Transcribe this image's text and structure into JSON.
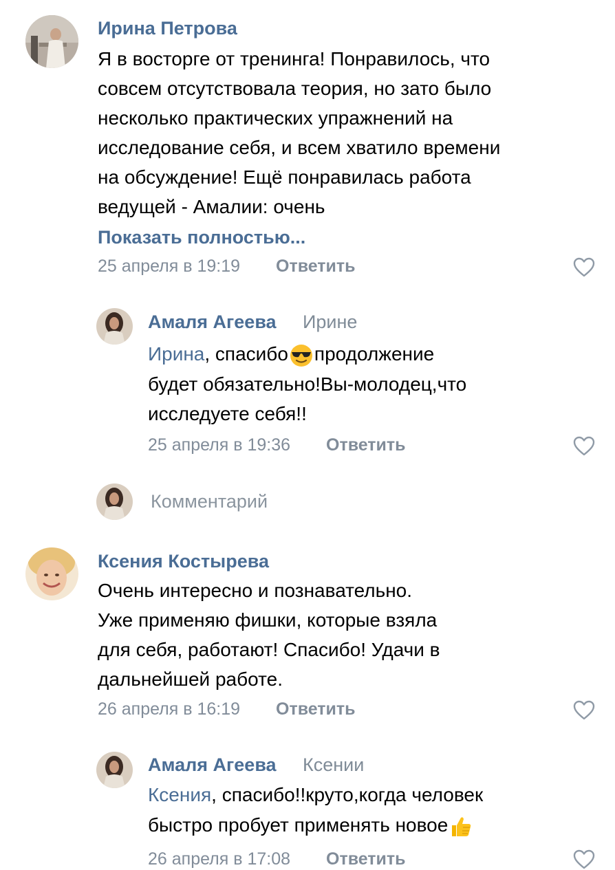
{
  "comments": [
    {
      "author": "Ирина Петрова",
      "lines": [
        "Я в восторге от тренинга! Понравилось, что",
        "совсем отсутствовала теория, но зато было",
        "несколько практических упражнений на",
        "исследование себя, и всем хватило времени",
        "на обсуждение! Ещё понравилась работа",
        "ведущей - Амалии: очень"
      ],
      "show_more": "Показать полностью...",
      "date": "25 апреля в 19:19",
      "reply_label": "Ответить",
      "reply": {
        "author": "Амаля Агеева",
        "to": "Ирине",
        "mention": "Ирина",
        "line1_rest": ", спасибо",
        "emoji": "smiling-face-with-sunglasses",
        "line1_after": "продолжение",
        "lines": [
          "будет обязательно!Вы-молодец,что",
          "исследуете себя!!"
        ],
        "date": "25 апреля в 19:36",
        "reply_label": "Ответить"
      },
      "comment_placeholder": "Комментарий"
    },
    {
      "author": "Ксения Костырева",
      "lines": [
        "Очень интересно и познавательно.",
        "Уже применяю фишки, которые взяла",
        "для себя, работают! Спасибо! Удачи в",
        "дальнейшей работе."
      ],
      "date": "26 апреля в 16:19",
      "reply_label": "Ответить",
      "reply": {
        "author": "Амаля Агеева",
        "to": "Ксении",
        "mention": "Ксения",
        "line1_rest": ", спасибо!!круто,когда человек",
        "line2": "быстро пробует применять новое",
        "emoji": "thumbs-up",
        "date": "26 апреля в 17:08",
        "reply_label": "Ответить"
      }
    }
  ],
  "colors": {
    "link": "#4a6d95",
    "meta": "#818c99",
    "text": "#000000"
  },
  "icons": [
    "heart-outline-icon",
    "avatar"
  ]
}
